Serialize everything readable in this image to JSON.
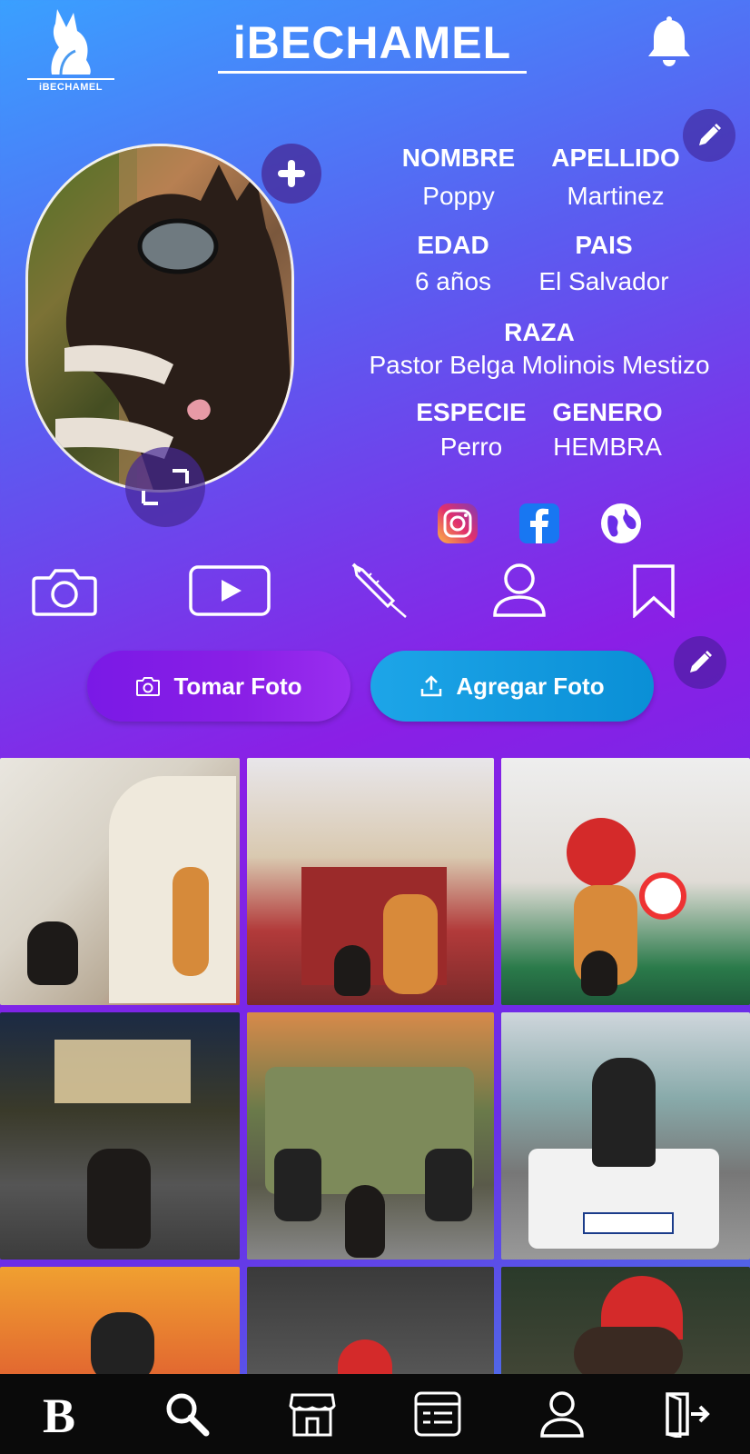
{
  "header": {
    "logo_text": "iBECHAMEL",
    "app_title": "iBECHAMEL"
  },
  "profile": {
    "fields": [
      {
        "label": "NOMBRE",
        "value": "Poppy"
      },
      {
        "label": "APELLIDO",
        "value": "Martinez"
      },
      {
        "label": "EDAD",
        "value": "6 años"
      },
      {
        "label": "PAIS",
        "value": "El Salvador"
      },
      {
        "label": "RAZA",
        "value": "Pastor Belga Molinois Mestizo"
      },
      {
        "label": "ESPECIE",
        "value": "Perro"
      },
      {
        "label": "GENERO",
        "value": "HEMBRA"
      }
    ]
  },
  "social": [
    "instagram-icon",
    "facebook-icon",
    "globe-icon"
  ],
  "tabs": [
    "camera-icon",
    "video-play-icon",
    "syringe-icon",
    "person-icon",
    "bookmark-icon"
  ],
  "actions": {
    "take_photo": "Tomar Foto",
    "add_photo": "Agregar Foto"
  },
  "bottom_nav": [
    "home-b-icon",
    "search-icon",
    "store-icon",
    "list-card-icon",
    "profile-icon",
    "logout-icon"
  ],
  "colors": {
    "take_photo_bg": "#8a1fe6",
    "add_photo_bg": "#0a8fd6",
    "nav_bg": "#0a0a0a"
  }
}
